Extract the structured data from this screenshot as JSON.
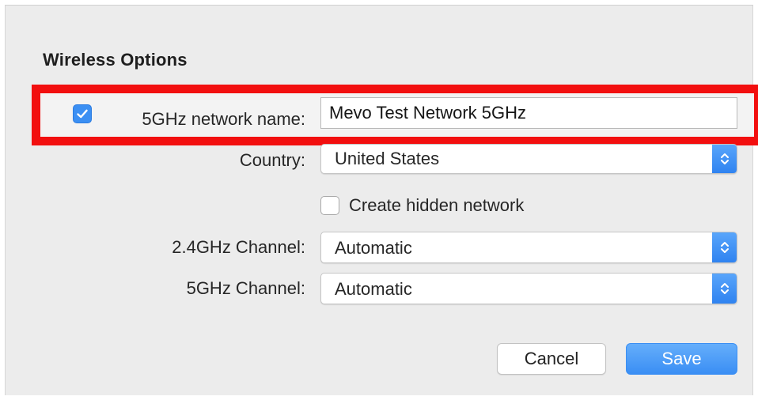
{
  "section_title": "Wireless Options",
  "network_name": {
    "checked": true,
    "label": "5GHz network name:",
    "value": "Mevo Test Network 5GHz"
  },
  "country": {
    "label": "Country:",
    "selected": "United States"
  },
  "hidden_network": {
    "checked": false,
    "label": "Create hidden network"
  },
  "channel_24": {
    "label": "2.4GHz Channel:",
    "selected": "Automatic"
  },
  "channel_5": {
    "label": "5GHz Channel:",
    "selected": "Automatic"
  },
  "buttons": {
    "cancel": "Cancel",
    "save": "Save"
  },
  "colors": {
    "highlight": "#f20f0f",
    "accent": "#3b8ff3",
    "dialog_bg": "#ececec"
  },
  "icons": {
    "checkmark": "checkmark-icon",
    "stepper": "up-down-chevron-icon"
  }
}
